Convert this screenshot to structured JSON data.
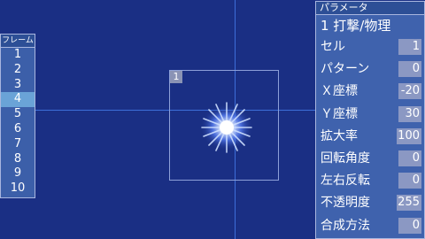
{
  "frames": {
    "header": "フレーム",
    "items": [
      "1",
      "2",
      "3",
      "4",
      "5",
      "6",
      "7",
      "8",
      "9",
      "10"
    ],
    "selected_index": 3
  },
  "canvas": {
    "cell_number": "1"
  },
  "params": {
    "header": "パラメータ",
    "title": "1 打撃/物理",
    "rows": [
      {
        "label": "セル",
        "value": "1"
      },
      {
        "label": "パターン",
        "value": "0"
      },
      {
        "label": "Ｘ座標",
        "value": "-20"
      },
      {
        "label": "Ｙ座標",
        "value": "30"
      },
      {
        "label": "拡大率",
        "value": "100"
      },
      {
        "label": "回転角度",
        "value": "0"
      },
      {
        "label": "左右反転",
        "value": "0"
      },
      {
        "label": "不透明度",
        "value": "255"
      },
      {
        "label": "合成方法",
        "value": "0"
      }
    ]
  },
  "colors": {
    "background": "#1a2f84",
    "panel": "#3f62ad",
    "selected": "#6aa3d7",
    "guide": "#3d6ed8"
  }
}
